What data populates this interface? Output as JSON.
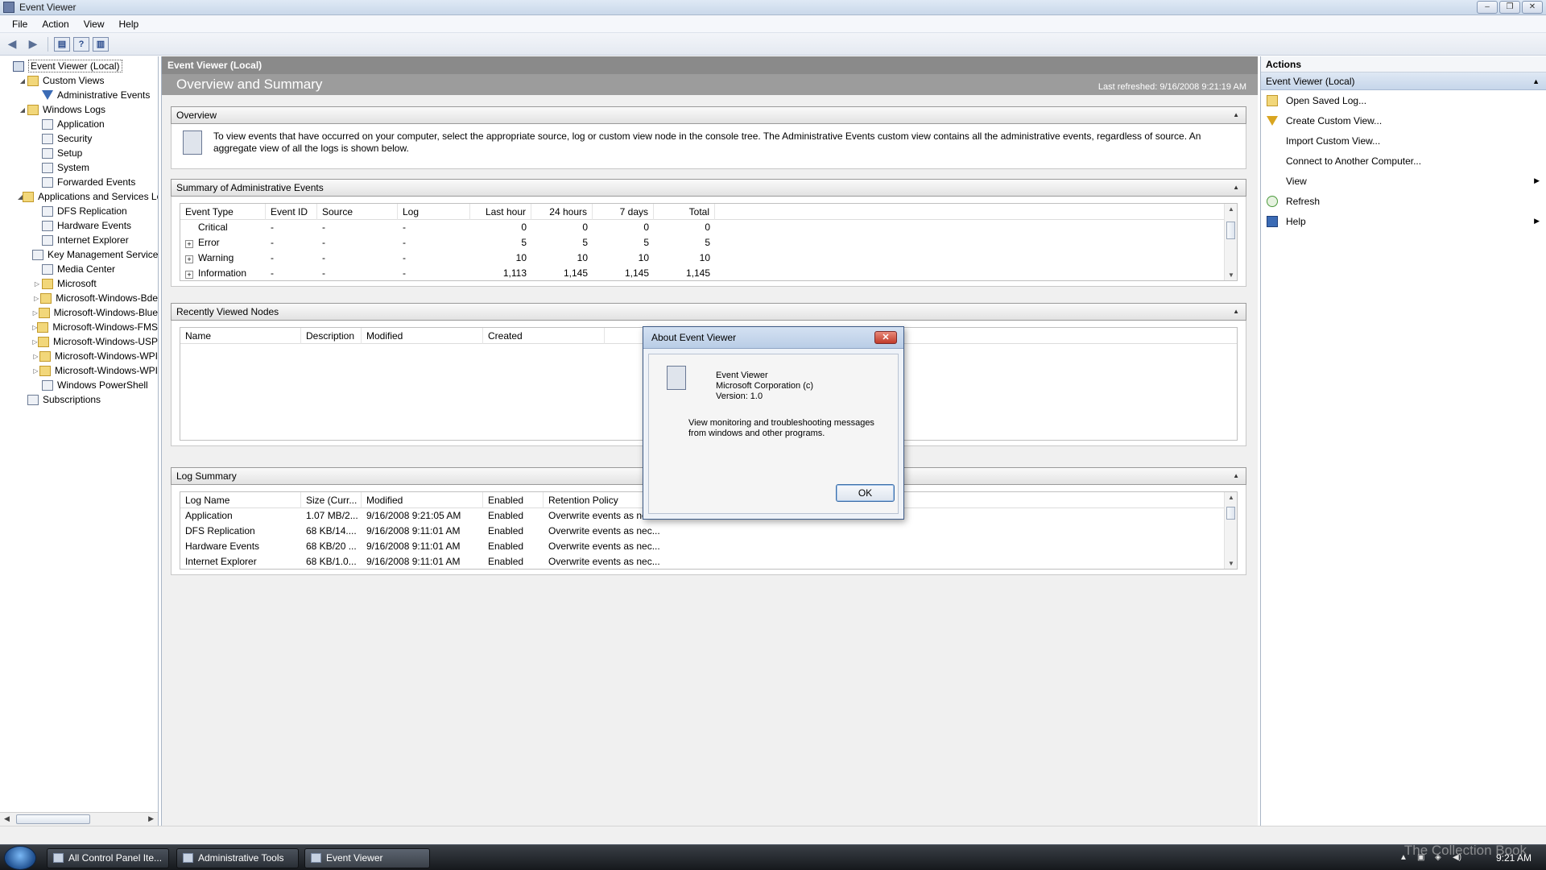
{
  "window": {
    "title": "Event Viewer"
  },
  "menu": [
    "File",
    "Action",
    "View",
    "Help"
  ],
  "tree": [
    {
      "label": "Event Viewer (Local)",
      "level": 0,
      "exp": "",
      "icon": "root",
      "selected": true,
      "name": "tree-event-viewer-local"
    },
    {
      "label": "Custom Views",
      "level": 1,
      "exp": "◢",
      "icon": "folder",
      "name": "tree-custom-views"
    },
    {
      "label": "Administrative Events",
      "level": 2,
      "exp": "",
      "icon": "funnel",
      "name": "tree-administrative-events"
    },
    {
      "label": "Windows Logs",
      "level": 1,
      "exp": "◢",
      "icon": "folder",
      "name": "tree-windows-logs"
    },
    {
      "label": "Application",
      "level": 2,
      "exp": "",
      "icon": "log",
      "name": "tree-application"
    },
    {
      "label": "Security",
      "level": 2,
      "exp": "",
      "icon": "log",
      "name": "tree-security"
    },
    {
      "label": "Setup",
      "level": 2,
      "exp": "",
      "icon": "log",
      "name": "tree-setup"
    },
    {
      "label": "System",
      "level": 2,
      "exp": "",
      "icon": "log",
      "name": "tree-system"
    },
    {
      "label": "Forwarded Events",
      "level": 2,
      "exp": "",
      "icon": "log",
      "name": "tree-forwarded-events"
    },
    {
      "label": "Applications and Services Lo",
      "level": 1,
      "exp": "◢",
      "icon": "folder",
      "name": "tree-applications-and-services"
    },
    {
      "label": "DFS Replication",
      "level": 2,
      "exp": "",
      "icon": "log",
      "name": "tree-dfs-replication"
    },
    {
      "label": "Hardware Events",
      "level": 2,
      "exp": "",
      "icon": "log",
      "name": "tree-hardware-events"
    },
    {
      "label": "Internet Explorer",
      "level": 2,
      "exp": "",
      "icon": "log",
      "name": "tree-internet-explorer"
    },
    {
      "label": "Key Management Service",
      "level": 2,
      "exp": "",
      "icon": "log",
      "name": "tree-key-management-service"
    },
    {
      "label": "Media Center",
      "level": 2,
      "exp": "",
      "icon": "log",
      "name": "tree-media-center"
    },
    {
      "label": "Microsoft",
      "level": 2,
      "exp": "▷",
      "icon": "folder",
      "name": "tree-microsoft"
    },
    {
      "label": "Microsoft-Windows-Bde",
      "level": 2,
      "exp": "▷",
      "icon": "folder",
      "name": "tree-microsoft-windows-bde"
    },
    {
      "label": "Microsoft-Windows-Blue",
      "level": 2,
      "exp": "▷",
      "icon": "folder",
      "name": "tree-microsoft-windows-blue"
    },
    {
      "label": "Microsoft-Windows-FMS",
      "level": 2,
      "exp": "▷",
      "icon": "folder",
      "name": "tree-microsoft-windows-fms"
    },
    {
      "label": "Microsoft-Windows-USP",
      "level": 2,
      "exp": "▷",
      "icon": "folder",
      "name": "tree-microsoft-windows-usp"
    },
    {
      "label": "Microsoft-Windows-WPI",
      "level": 2,
      "exp": "▷",
      "icon": "folder",
      "name": "tree-microsoft-windows-wpi-1"
    },
    {
      "label": "Microsoft-Windows-WPI",
      "level": 2,
      "exp": "▷",
      "icon": "folder",
      "name": "tree-microsoft-windows-wpi-2"
    },
    {
      "label": "Windows PowerShell",
      "level": 2,
      "exp": "",
      "icon": "log",
      "name": "tree-windows-powershell"
    },
    {
      "label": "Subscriptions",
      "level": 1,
      "exp": "",
      "icon": "log",
      "name": "tree-subscriptions"
    }
  ],
  "center": {
    "header": "Event Viewer (Local)",
    "title": "Overview and Summary",
    "refreshed": "Last refreshed: 9/16/2008 9:21:19 AM",
    "overview": {
      "heading": "Overview",
      "text": "To view events that have occurred on your computer, select the appropriate source, log or custom view node in the console tree. The Administrative Events custom view contains all the administrative events, regardless of source. An aggregate view of all the logs is shown below."
    },
    "summary": {
      "heading": "Summary of Administrative Events",
      "columns": [
        "Event Type",
        "Event ID",
        "Source",
        "Log",
        "Last hour",
        "24 hours",
        "7 days",
        "Total"
      ],
      "rows": [
        {
          "type": "Critical",
          "expand": false,
          "id": "-",
          "source": "-",
          "log": "-",
          "hour": "0",
          "day": "0",
          "week": "0",
          "total": "0"
        },
        {
          "type": "Error",
          "expand": true,
          "id": "-",
          "source": "-",
          "log": "-",
          "hour": "5",
          "day": "5",
          "week": "5",
          "total": "5"
        },
        {
          "type": "Warning",
          "expand": true,
          "id": "-",
          "source": "-",
          "log": "-",
          "hour": "10",
          "day": "10",
          "week": "10",
          "total": "10"
        },
        {
          "type": "Information",
          "expand": true,
          "id": "-",
          "source": "-",
          "log": "-",
          "hour": "1,113",
          "day": "1,145",
          "week": "1,145",
          "total": "1,145"
        }
      ]
    },
    "recent": {
      "heading": "Recently Viewed Nodes",
      "columns": [
        "Name",
        "Description",
        "Modified",
        "Created"
      ]
    },
    "logsummary": {
      "heading": "Log Summary",
      "columns": [
        "Log Name",
        "Size (Curr...",
        "Modified",
        "Enabled",
        "Retention Policy"
      ],
      "rows": [
        {
          "name": "Application",
          "size": "1.07 MB/2...",
          "modified": "9/16/2008 9:21:05 AM",
          "enabled": "Enabled",
          "policy": "Overwrite events as nec..."
        },
        {
          "name": "DFS Replication",
          "size": "68 KB/14....",
          "modified": "9/16/2008 9:11:01 AM",
          "enabled": "Enabled",
          "policy": "Overwrite events as nec..."
        },
        {
          "name": "Hardware Events",
          "size": "68 KB/20 ...",
          "modified": "9/16/2008 9:11:01 AM",
          "enabled": "Enabled",
          "policy": "Overwrite events as nec..."
        },
        {
          "name": "Internet Explorer",
          "size": "68 KB/1.0...",
          "modified": "9/16/2008 9:11:01 AM",
          "enabled": "Enabled",
          "policy": "Overwrite events as nec..."
        }
      ]
    }
  },
  "actions": {
    "heading": "Actions",
    "group": "Event Viewer (Local)",
    "items": [
      {
        "label": "Open Saved Log...",
        "icon": "open-log",
        "submenu": false,
        "name": "action-open-saved-log"
      },
      {
        "label": "Create Custom View...",
        "icon": "funnel",
        "submenu": false,
        "name": "action-create-custom-view"
      },
      {
        "label": "Import Custom View...",
        "icon": "",
        "submenu": false,
        "name": "action-import-custom-view"
      },
      {
        "label": "Connect to Another Computer...",
        "icon": "",
        "submenu": false,
        "name": "action-connect-another-computer"
      },
      {
        "label": "View",
        "icon": "",
        "submenu": true,
        "name": "action-view"
      },
      {
        "label": "Refresh",
        "icon": "refresh",
        "submenu": false,
        "name": "action-refresh"
      },
      {
        "label": "Help",
        "icon": "help",
        "submenu": true,
        "name": "action-help"
      }
    ]
  },
  "dialog": {
    "title": "About Event Viewer",
    "product": "Event Viewer",
    "company": "Microsoft Corporation (c)",
    "version": "Version: 1.0",
    "description": "View monitoring and troubleshooting messages from windows and other programs.",
    "ok": "OK"
  },
  "taskbar": {
    "tasks": [
      {
        "label": "All Control Panel Ite...",
        "active": false
      },
      {
        "label": "Administrative Tools",
        "active": false
      },
      {
        "label": "Event Viewer",
        "active": true
      }
    ],
    "clock": "9:21 AM",
    "watermark": "The Collection Book"
  }
}
